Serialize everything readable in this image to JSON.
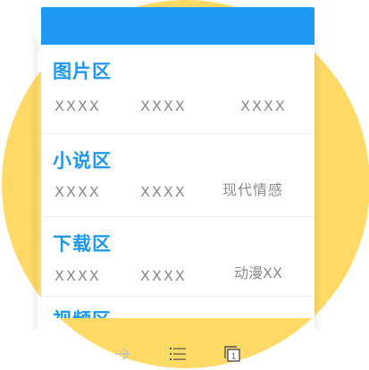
{
  "sections": [
    {
      "title": "图片区",
      "items": [
        "XXXX",
        "XXXX",
        "XXXX"
      ]
    },
    {
      "title": "小说区",
      "items": [
        "XXXX",
        "XXXX",
        "现代情感"
      ]
    },
    {
      "title": "下载区",
      "items": [
        "XXXX",
        "XXXX",
        "动漫XX"
      ]
    },
    {
      "title": "视频区",
      "items": []
    }
  ],
  "bottom_bar": {
    "icons": [
      "arrow-right-icon",
      "list-icon",
      "tabs-icon"
    ],
    "tab_count": "1"
  },
  "colors": {
    "accent": "#1e9af5",
    "title": "#1f97ea",
    "background_circle": "#fed966",
    "item_text": "#8b8b8b"
  }
}
